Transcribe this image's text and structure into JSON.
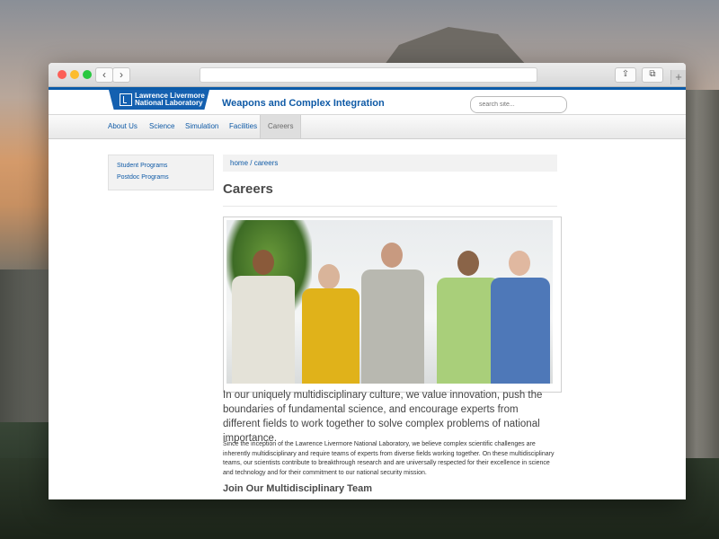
{
  "window": {
    "back_glyph": "‹",
    "forward_glyph": "›",
    "share_glyph": "⇪",
    "tabs_glyph": "⧉",
    "new_tab_glyph": "+"
  },
  "logo": {
    "line1": "Lawrence Livermore",
    "line2": "National Laboratory"
  },
  "header": {
    "site_title": "Weapons and Complex Integration",
    "search_placeholder": "search site..."
  },
  "nav": {
    "items": [
      {
        "label": "About Us"
      },
      {
        "label": "Science"
      },
      {
        "label": "Simulation"
      },
      {
        "label": "Facilities"
      },
      {
        "label": "Careers",
        "active": true
      }
    ]
  },
  "sidebar": {
    "items": [
      {
        "label": "Student Programs"
      },
      {
        "label": "Postdoc Programs"
      }
    ]
  },
  "breadcrumb": {
    "home": "home",
    "separator": " / ",
    "current": "careers"
  },
  "page": {
    "title": "Careers",
    "lead": "In our uniquely multidisciplinary culture, we value innovation, push the boundaries of fundamental science, and encourage experts from different fields to work together to solve complex problems of national importance.",
    "body": "Since the inception of the Lawrence Livermore National Laboratory, we believe complex scientific challenges are inherently multidisciplinary and require teams of experts from diverse fields working together. On these multidisciplinary teams, our scientists contribute to breakthrough research and are universally respected for their excellence in science and technology and for their commitment to our national security mission.",
    "section_heading": "Join Our Multidisciplinary Team"
  },
  "colors": {
    "brand_blue": "#0f5aa6",
    "logo_blue": "#1460b0"
  }
}
